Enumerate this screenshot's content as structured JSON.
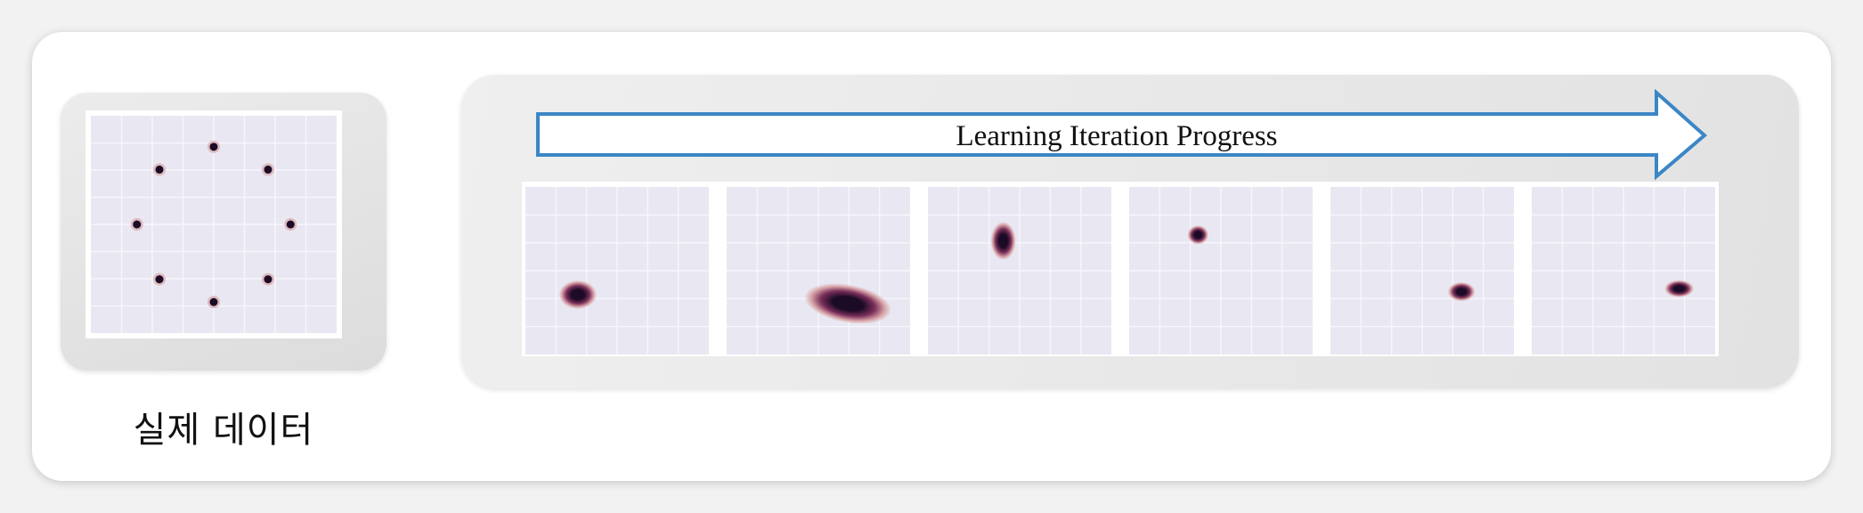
{
  "real_data": {
    "label": "실제 데이터",
    "chart_data": {
      "type": "scatter",
      "title": "",
      "points": [
        {
          "x": 0.0,
          "y": 1.0
        },
        {
          "x": 0.707,
          "y": 0.707
        },
        {
          "x": 1.0,
          "y": 0.0
        },
        {
          "x": 0.707,
          "y": -0.707
        },
        {
          "x": 0.0,
          "y": -1.0
        },
        {
          "x": -0.707,
          "y": -0.707
        },
        {
          "x": -1.0,
          "y": 0.0
        },
        {
          "x": -0.707,
          "y": 0.707
        }
      ],
      "xlim": [
        -1.6,
        1.6
      ],
      "ylim": [
        -1.4,
        1.4
      ],
      "grid": true
    }
  },
  "progress": {
    "arrow_label": "Learning Iteration Progress",
    "arrow_color": "#3b86c6"
  },
  "chart_data": [
    {
      "type": "heatmap",
      "center": {
        "x": -0.6,
        "y": -0.4
      },
      "spread": {
        "x": 0.18,
        "y": 0.15
      },
      "angle": 0
    },
    {
      "type": "heatmap",
      "center": {
        "x": 0.45,
        "y": -0.55
      },
      "spread": {
        "x": 0.42,
        "y": 0.2
      },
      "angle": 10
    },
    {
      "type": "heatmap",
      "center": {
        "x": -0.25,
        "y": 0.5
      },
      "spread": {
        "x": 0.12,
        "y": 0.2
      },
      "angle": 0
    },
    {
      "type": "heatmap",
      "center": {
        "x": -0.35,
        "y": 0.6
      },
      "spread": {
        "x": 0.1,
        "y": 0.1
      },
      "angle": 0
    },
    {
      "type": "heatmap",
      "center": {
        "x": 0.6,
        "y": -0.35
      },
      "spread": {
        "x": 0.13,
        "y": 0.1
      },
      "angle": 0
    },
    {
      "type": "heatmap",
      "center": {
        "x": 0.85,
        "y": -0.3
      },
      "spread": {
        "x": 0.14,
        "y": 0.09
      },
      "angle": 0
    }
  ],
  "colors": {
    "plot_bg": "#e8e7f2",
    "grid": "#f7f6fb",
    "density_core": "#1c0b26",
    "density_mid": "#7a2f5a",
    "density_outer": "#d9a6a9"
  }
}
